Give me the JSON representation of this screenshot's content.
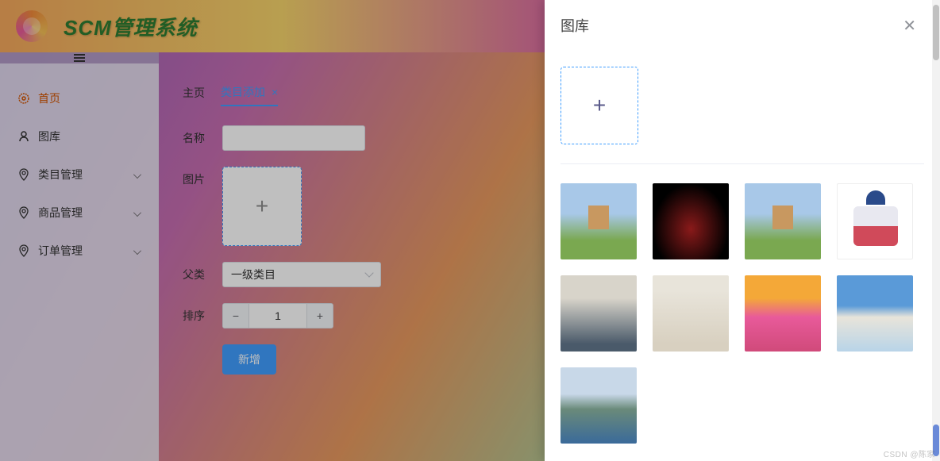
{
  "app": {
    "title": "SCM管理系统"
  },
  "sidebar": {
    "items": [
      {
        "label": "首页",
        "icon": "gear-icon",
        "active": true
      },
      {
        "label": "图库",
        "icon": "user-icon"
      },
      {
        "label": "类目管理",
        "icon": "pin-icon",
        "expandable": true
      },
      {
        "label": "商品管理",
        "icon": "pin-icon",
        "expandable": true
      },
      {
        "label": "订单管理",
        "icon": "pin-icon",
        "expandable": true
      }
    ]
  },
  "tabs": [
    {
      "label": "主页",
      "active": false
    },
    {
      "label": "类目添加",
      "active": true,
      "closable": true
    }
  ],
  "form": {
    "name_label": "名称",
    "name_value": "",
    "image_label": "图片",
    "parent_label": "父类",
    "parent_value": "一级类目",
    "sort_label": "排序",
    "sort_value": "1",
    "submit_label": "新增"
  },
  "drawer": {
    "title": "图库",
    "images": [
      {
        "name": "danbo-sky-1"
      },
      {
        "name": "sports-car-dark"
      },
      {
        "name": "danbo-sky-2"
      },
      {
        "name": "baby-clothes"
      },
      {
        "name": "hoodie-model"
      },
      {
        "name": "cardigan-model"
      },
      {
        "name": "sunset-sea"
      },
      {
        "name": "winter-trees"
      },
      {
        "name": "mountain-lake"
      }
    ]
  },
  "watermark": "CSDN @陈家"
}
